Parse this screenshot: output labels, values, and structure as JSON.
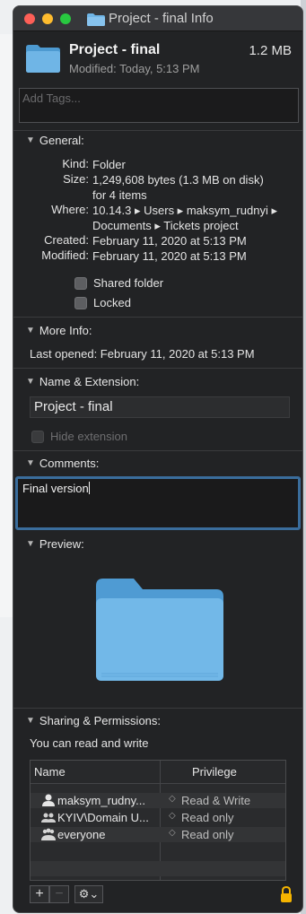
{
  "window": {
    "title": "Project - final Info"
  },
  "header": {
    "name": "Project - final",
    "size": "1.2 MB",
    "modified": "Modified: Today, 5:13 PM"
  },
  "tags": {
    "placeholder": "Add Tags..."
  },
  "general": {
    "title": "General:",
    "kind_label": "Kind:",
    "kind": "Folder",
    "size_label": "Size:",
    "size_line1": "1,249,608 bytes (1.3 MB on disk)",
    "size_line2": "for 4 items",
    "where_label": "Where:",
    "where_line1": "10.14.3 ▸ Users ▸ maksym_rudnyi ▸",
    "where_line2": "Documents ▸ Tickets project",
    "created_label": "Created:",
    "created": "February 11, 2020 at 5:13 PM",
    "modified_label": "Modified:",
    "modified": "February 11, 2020 at 5:13 PM",
    "shared_folder": "Shared folder",
    "locked": "Locked"
  },
  "more_info": {
    "title": "More Info:",
    "last_opened": "Last opened: February 11, 2020 at 5:13 PM"
  },
  "name_ext": {
    "title": "Name & Extension:",
    "value": "Project - final",
    "hide_extension": "Hide extension"
  },
  "comments": {
    "title": "Comments:",
    "value": "Final version"
  },
  "preview": {
    "title": "Preview:"
  },
  "sharing": {
    "title": "Sharing & Permissions:",
    "summary": "You can read and write",
    "col_name": "Name",
    "col_privilege": "Privilege",
    "rows": [
      {
        "name": "maksym_rudny...",
        "privilege": "Read & Write"
      },
      {
        "name": "KYIV\\Domain U...",
        "privilege": "Read only"
      },
      {
        "name": "everyone",
        "privilege": "Read only"
      }
    ],
    "add": "+",
    "remove": "−",
    "gear": "⚙⌄"
  },
  "colors": {
    "folder": "#6fb5e6",
    "accent": "#3a6d9c",
    "background": "#222325"
  },
  "icons": [
    "folder-icon",
    "person-icon",
    "group-icon",
    "everyone-icon",
    "gear-icon",
    "lock-icon",
    "disclosure-triangle-icon"
  ]
}
